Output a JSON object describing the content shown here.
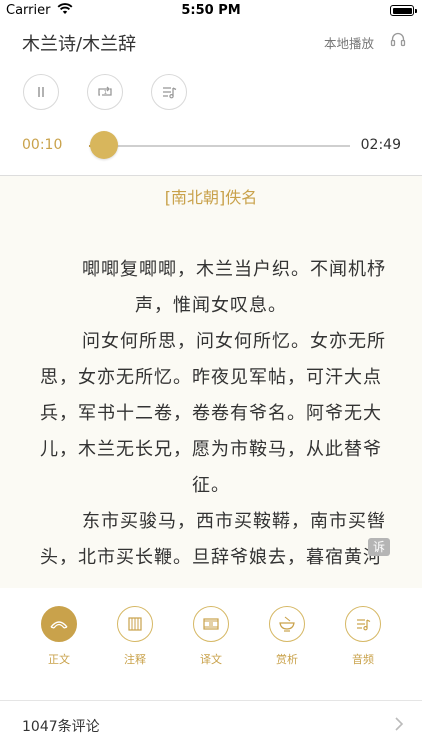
{
  "status_bar": {
    "carrier": "Carrier",
    "time": "5:50 PM"
  },
  "header": {
    "title": "木兰诗/木兰辞",
    "local_play": "本地播放"
  },
  "player": {
    "current_time": "00:10",
    "total_time": "02:49",
    "progress_fraction": 0.059
  },
  "poem": {
    "author": "[南北朝]佚名",
    "line1": "唧唧复唧唧，木兰当户织。不闻机杼",
    "line2": "声，惟闻女叹息。",
    "line3": "问女何所思，问女何所忆。女亦无所",
    "line4": "思，女亦无所忆。昨夜见军帖，可汗大点",
    "line5": "兵，军书十二卷，卷卷有爷名。阿爷无大",
    "line6": "儿，木兰无长兄，愿为市鞍马，从此替爷",
    "line7": "征。",
    "line8": "东市买骏马，西市买鞍鞯，南市买辔",
    "line9": "头，北市买长鞭。旦辞爷娘去，暮宿黄河",
    "gloss_badge": "诉"
  },
  "tabs": [
    {
      "label": "正文",
      "icon": "fan-icon",
      "active": true
    },
    {
      "label": "注释",
      "icon": "scroll-icon",
      "active": false
    },
    {
      "label": "译文",
      "icon": "translation-icon",
      "active": false
    },
    {
      "label": "赏析",
      "icon": "tea-bowl-icon",
      "active": false
    },
    {
      "label": "音频",
      "icon": "audio-list-icon",
      "active": false
    }
  ],
  "comments": {
    "label": "1047条评论"
  },
  "colors": {
    "accent": "#c9a24b",
    "poem_bg": "#fbfaf4"
  }
}
